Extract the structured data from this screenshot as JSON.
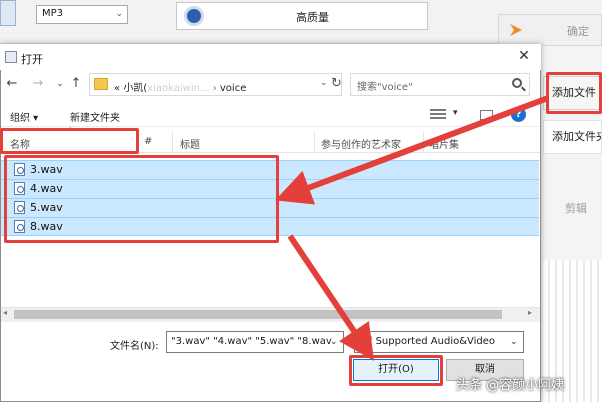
{
  "background_app": {
    "format_select": "MP3",
    "quality_label": "高质量",
    "confirm_label": "确定",
    "add_file_label": "添加文件",
    "add_folder_label": "添加文件夹",
    "cut_label": "剪辑"
  },
  "dialog": {
    "title": "打开",
    "address": {
      "prefix": "«",
      "segment1": "小凯(",
      "segment1_blurred": "xiaokaiwin...",
      "segment2": "voice"
    },
    "search_placeholder": "搜索\"voice\"",
    "toolbar": {
      "organize": "组织 ▾",
      "new_folder": "新建文件夹"
    },
    "columns": {
      "name": "名称",
      "number": "#",
      "title": "标题",
      "artist": "参与创作的艺术家",
      "album": "唱片集"
    },
    "files": [
      {
        "name": "3.wav"
      },
      {
        "name": "4.wav"
      },
      {
        "name": "5.wav"
      },
      {
        "name": "8.wav"
      }
    ],
    "filename_label": "文件名(N):",
    "filename_value": "\"3.wav\" \"4.wav\" \"5.wav\" \"8.wav",
    "filetype_value": "All Supported Audio&Video",
    "open_button": "打开(O)",
    "cancel_button": "取消"
  },
  "annotation_color": "#e4403b",
  "watermark": "头条 @容颜小阿姨"
}
